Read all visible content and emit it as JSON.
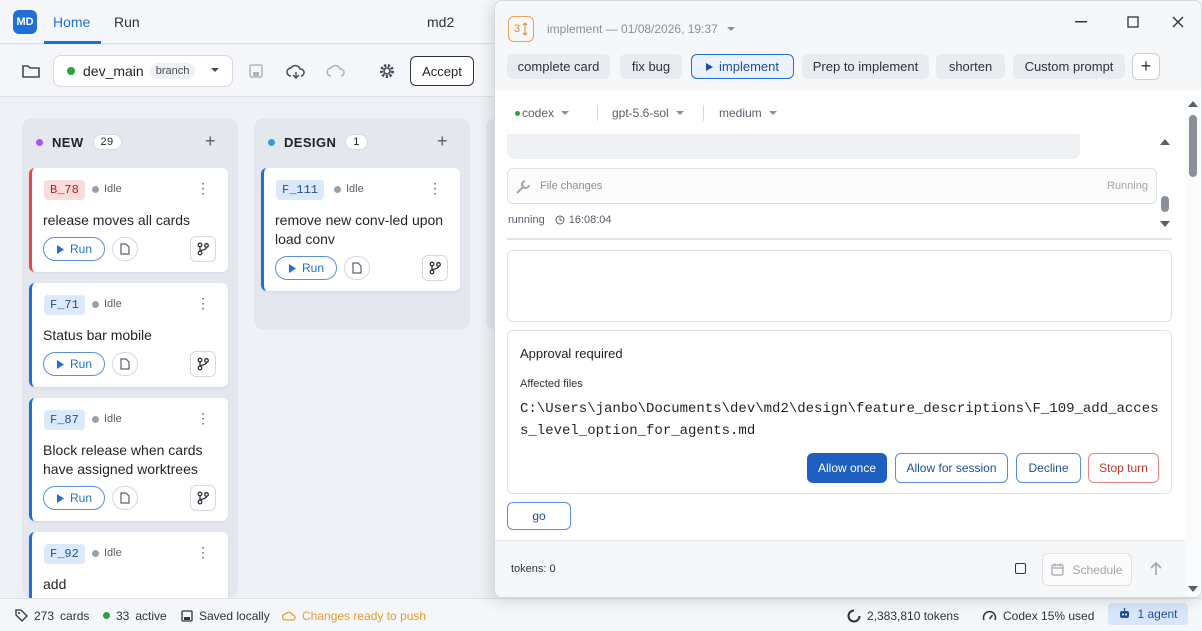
{
  "app": {
    "logo_text": "MD",
    "title": "md2",
    "tabs": [
      {
        "label": "Home"
      },
      {
        "label": "Run"
      }
    ]
  },
  "toolbar": {
    "branch_name": "dev_main",
    "branch_tag": "branch",
    "accept_label": "Accept"
  },
  "columns": [
    {
      "name": "NEW",
      "count": "29",
      "dot_color": "#a855f7",
      "cards": [
        {
          "id": "B_78",
          "status": "Idle",
          "title": "release moves all cards",
          "run": "Run"
        },
        {
          "id": "F_71",
          "status": "Idle",
          "title": "Status bar mobile",
          "run": "Run"
        },
        {
          "id": "F_87",
          "status": "Idle",
          "title": "Block release when cards have assigned worktrees",
          "run": "Run"
        },
        {
          "id": "F_92",
          "status": "Idle",
          "title": "add",
          "run": "Run"
        }
      ]
    },
    {
      "name": "DESIGN",
      "count": "1",
      "dot_color": "#2aa1d8",
      "cards": [
        {
          "id": "F_111",
          "status": "Idle",
          "title": "remove new conv-led upon load conv",
          "run": "Run"
        }
      ]
    }
  ],
  "statusbar": {
    "cards_count": "273",
    "cards_label": "cards",
    "active_count": "33",
    "active_label": "active",
    "saved": "Saved locally",
    "changes": "Changes ready to push",
    "tokens": "2,383,810 tokens",
    "codex": "Codex 15% used",
    "agents": "1 agent"
  },
  "dialog": {
    "counter": "3",
    "title": "implement — 01/08/2026, 19:37",
    "chips": [
      "complete card",
      "fix bug",
      "implement",
      "Prep to implement",
      "shorten",
      "Custom prompt"
    ],
    "selectors": {
      "provider": "codex",
      "model": "gpt-5.6-sol",
      "effort": "medium"
    },
    "file_changes_label": "File changes",
    "file_changes_status": "Running",
    "running_label": "running",
    "running_time": "16:08:04",
    "approval": {
      "title": "Approval required",
      "subtitle": "Affected files",
      "path": "C:\\Users\\janbo\\Documents\\dev\\md2\\design\\feature_descriptions\\F_109_add_access_level_option_for_agents.md",
      "allow_once": "Allow once",
      "allow_session": "Allow for session",
      "decline": "Decline",
      "stop": "Stop turn"
    },
    "go_label": "go",
    "tokens": "tokens: 0",
    "schedule": "Schedule"
  },
  "colors": {
    "accent": "#1f6fd6",
    "danger": "#e5484d",
    "warning": "#e08a2c",
    "success": "#2ea043"
  }
}
